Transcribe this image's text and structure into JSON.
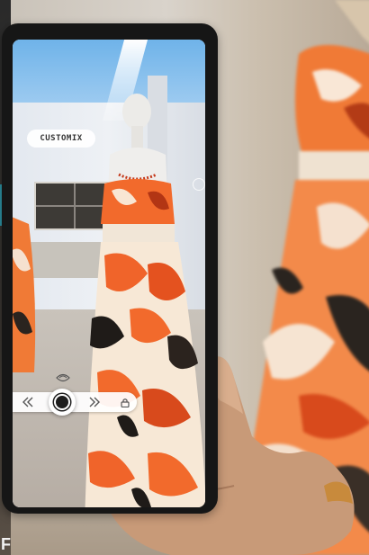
{
  "ar_app": {
    "brand_label": "CUSTOMIX",
    "controls": {
      "previous_icon": "chevron-double-left",
      "capture_icon": "record-circle",
      "next_icon": "chevron-double-right",
      "lock_icon": "lock"
    }
  },
  "colors": {
    "dress_orange": "#f0642a",
    "tablet_bezel": "#161616",
    "control_bar": "#ffffff"
  }
}
